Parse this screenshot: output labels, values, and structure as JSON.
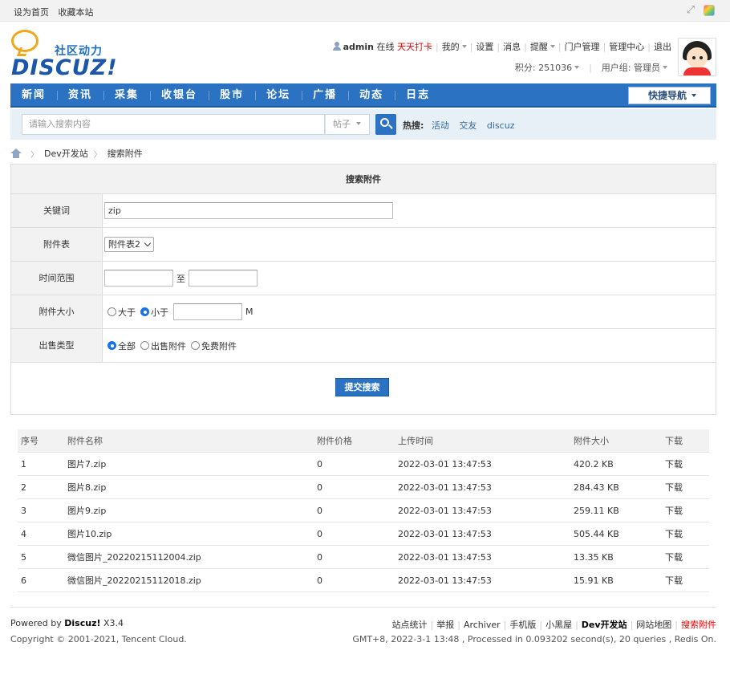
{
  "topbar": {
    "set_home": "设为首页",
    "bookmark": "收藏本站"
  },
  "logo": {
    "cn": "社区动力",
    "en": "DISCUZ!"
  },
  "userbar": {
    "username": "admin",
    "online": "在线",
    "checkin": "天天打卡",
    "my": "我的",
    "settings": "设置",
    "messages": "消息",
    "remind": "提醒",
    "portal_admin": "门户管理",
    "admin_center": "管理中心",
    "logout": "退出",
    "credits": "积分: 251036",
    "usergroup": "用户组: 管理员"
  },
  "nav": {
    "items": [
      "新闻",
      "资讯",
      "采集",
      "收银台",
      "股市",
      "论坛",
      "广播",
      "动态",
      "日志"
    ],
    "quick_nav": "快捷导航"
  },
  "search": {
    "placeholder": "请输入搜索内容",
    "type": "帖子",
    "hot_label": "热搜:",
    "hot_keywords": [
      "活动",
      "交友",
      "discuz"
    ]
  },
  "breadcrumb": {
    "items": [
      "Dev开发站",
      "搜索附件"
    ]
  },
  "form": {
    "title": "搜索附件",
    "keyword_label": "关键词",
    "keyword_value": "zip",
    "table_label": "附件表",
    "table_value": "附件表2",
    "time_label": "时间范围",
    "time_to": "至",
    "size_label": "附件大小",
    "size_greater": "大于",
    "size_less": "小于",
    "size_unit": "M",
    "sale_label": "出售类型",
    "sale_all": "全部",
    "sale_paid": "出售附件",
    "sale_free": "免费附件",
    "submit": "提交搜索"
  },
  "results": {
    "headers": [
      "序号",
      "附件名称",
      "附件价格",
      "上传时间",
      "附件大小",
      "下载"
    ],
    "rows": [
      {
        "no": "1",
        "name": "图片7.zip",
        "price": "0",
        "time": "2022-03-01 13:47:53",
        "size": "420.2 KB",
        "download": "下载"
      },
      {
        "no": "2",
        "name": "图片8.zip",
        "price": "0",
        "time": "2022-03-01 13:47:53",
        "size": "284.43 KB",
        "download": "下载"
      },
      {
        "no": "3",
        "name": "图片9.zip",
        "price": "0",
        "time": "2022-03-01 13:47:53",
        "size": "259.11 KB",
        "download": "下载"
      },
      {
        "no": "4",
        "name": "图片10.zip",
        "price": "0",
        "time": "2022-03-01 13:47:53",
        "size": "505.44 KB",
        "download": "下载"
      },
      {
        "no": "5",
        "name": "微信图片_20220215112004.zip",
        "price": "0",
        "time": "2022-03-01 13:47:53",
        "size": "13.35 KB",
        "download": "下载"
      },
      {
        "no": "6",
        "name": "微信图片_20220215112018.zip",
        "price": "0",
        "time": "2022-03-01 13:47:53",
        "size": "15.91 KB",
        "download": "下载"
      }
    ]
  },
  "footer": {
    "powered_prefix": "Powered by",
    "powered_brand": "Discuz!",
    "powered_version": "X3.4",
    "copyright": "Copyright © 2001-2021, Tencent Cloud.",
    "links": [
      "站点统计",
      "举报",
      "Archiver",
      "手机版",
      "小黑屋",
      "Dev开发站",
      "网站地图",
      "搜索附件"
    ],
    "status": "GMT+8, 2022-3-1 13:48 , Processed in 0.093202 second(s), 20 queries , Redis On."
  }
}
